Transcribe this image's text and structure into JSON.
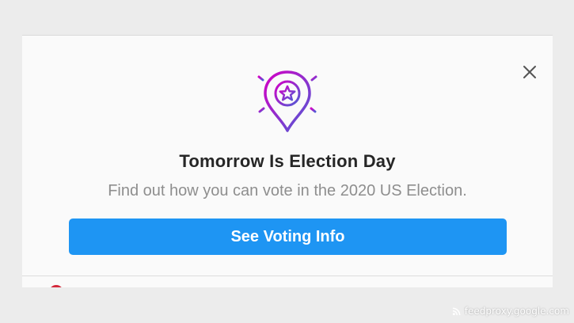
{
  "card": {
    "icon": "location-pin-star-icon",
    "title": "Tomorrow Is Election Day",
    "subtitle": "Find out how you can vote in the 2020 US Election.",
    "cta_label": "See Voting Info",
    "close_icon": "close-icon"
  },
  "watermark": {
    "icon": "rss-icon",
    "text": "feedproxy.google.com"
  },
  "colors": {
    "cta_background": "#1e95f3",
    "title_text": "#262626",
    "subtitle_text": "#8e8e8e",
    "icon_gradient_start": "#d300c5",
    "icon_gradient_end": "#4f5bd5"
  }
}
